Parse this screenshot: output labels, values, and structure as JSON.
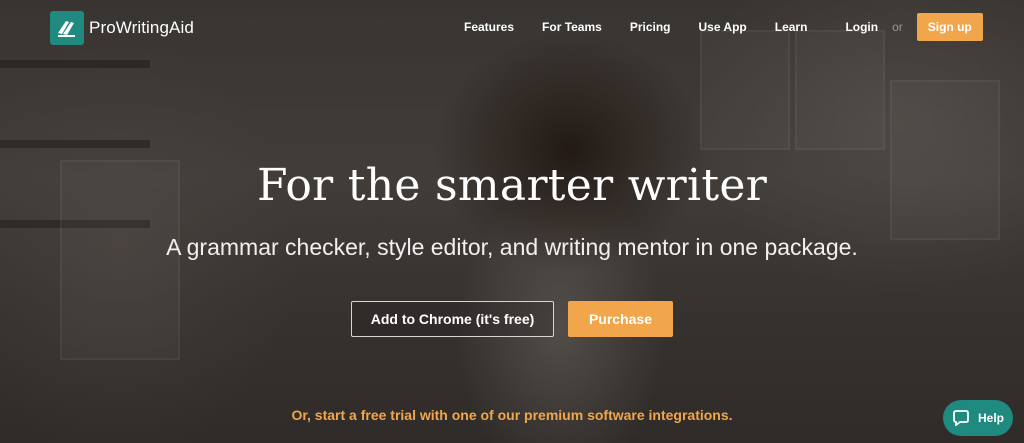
{
  "brand": {
    "name": "ProWritingAid",
    "logo_icon": "quill-stack-icon",
    "color": "#1f8a7f"
  },
  "nav": {
    "items": [
      {
        "label": "Features"
      },
      {
        "label": "For Teams"
      },
      {
        "label": "Pricing"
      },
      {
        "label": "Use App"
      },
      {
        "label": "Learn"
      }
    ],
    "login_label": "Login",
    "or_label": "or",
    "signup_label": "Sign up"
  },
  "hero": {
    "headline": "For the smarter writer",
    "subline": "A grammar checker, style editor, and writing mentor in one package.",
    "chrome_button_label": "Add to Chrome (it's free)",
    "purchase_button_label": "Purchase",
    "trial_text": "Or, start a free trial with one of our premium software integrations."
  },
  "help_widget": {
    "label": "Help",
    "icon": "chat-bubble-icon",
    "color": "#1e8a80"
  },
  "colors": {
    "accent": "#f2a64b",
    "teal": "#1f8a7f"
  }
}
